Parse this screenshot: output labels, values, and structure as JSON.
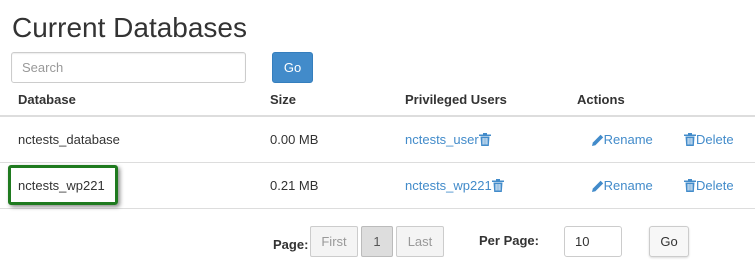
{
  "page": {
    "title": "Current Databases"
  },
  "search": {
    "placeholder": "Search",
    "value": "",
    "button_label": "Go"
  },
  "table": {
    "headers": {
      "database": "Database",
      "size": "Size",
      "users": "Privileged Users",
      "actions": "Actions"
    },
    "rows": [
      {
        "database": "nctests_database",
        "size": "0.00 MB",
        "user": "nctests_user",
        "rename": "Rename",
        "delete": "Delete"
      },
      {
        "database": "nctests_wp221",
        "size": "0.21 MB",
        "user": "nctests_wp221",
        "rename": "Rename",
        "delete": "Delete"
      }
    ]
  },
  "pagination": {
    "page_label": "Page:",
    "first": "First",
    "current": "1",
    "last": "Last",
    "per_page_label": "Per Page:",
    "per_page_value": "10",
    "go_label": "Go"
  },
  "colors": {
    "link": "#428bca",
    "primary_button": "#428bca",
    "highlight_border": "#1f7a1f"
  },
  "icons": {
    "trash": "trash-icon",
    "pencil": "pencil-icon"
  }
}
